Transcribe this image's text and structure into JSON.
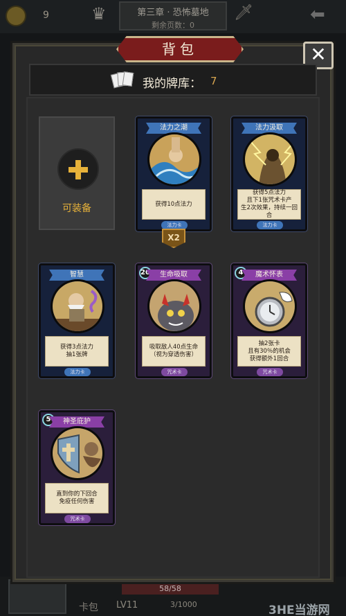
{
  "hud": {
    "coins": "9",
    "chapter_title": "第三章 · 恐怖墓地",
    "pages_left": "剩余页数：0"
  },
  "bottom": {
    "hp": "58/58",
    "bag_label": "卡包",
    "level": "LV11",
    "exp": "3/1000",
    "watermark": "3HE当游网"
  },
  "panel": {
    "title": "背包",
    "close_label": "✕",
    "deck_label": "我的牌库：",
    "deck_count": "7",
    "equip_label": "可装备"
  },
  "cards": [
    {
      "name": "法力之潮",
      "desc": "获得10点法力",
      "type": "法力卡",
      "cost": "",
      "multiplier": "X2",
      "color": "#3f74b8"
    },
    {
      "name": "法力汲取",
      "desc": "获得5点法力\n且下1张咒术卡产\n生2次效果，持续一回合",
      "type": "法力卡",
      "cost": "",
      "color": "#3f74b8"
    },
    {
      "name": "智慧",
      "desc": "获得3点法力\n抽1张牌",
      "type": "法力卡",
      "cost": "",
      "color": "#3f74b8"
    },
    {
      "name": "生命吸取",
      "desc": "吸取敌人40点生命\n（视为穿透伤害）",
      "type": "咒术卡",
      "cost": "20",
      "color": "#8a3fa6"
    },
    {
      "name": "魔术怀表",
      "desc": "抽2张卡\n且有30％的机会\n获得额外1回合",
      "type": "咒术卡",
      "cost": "4",
      "color": "#8a3fa6"
    },
    {
      "name": "神圣庇护",
      "desc": "直到你的下回合\n免疫任何伤害",
      "type": "咒术卡",
      "cost": "5",
      "color": "#8a3fa6"
    }
  ]
}
